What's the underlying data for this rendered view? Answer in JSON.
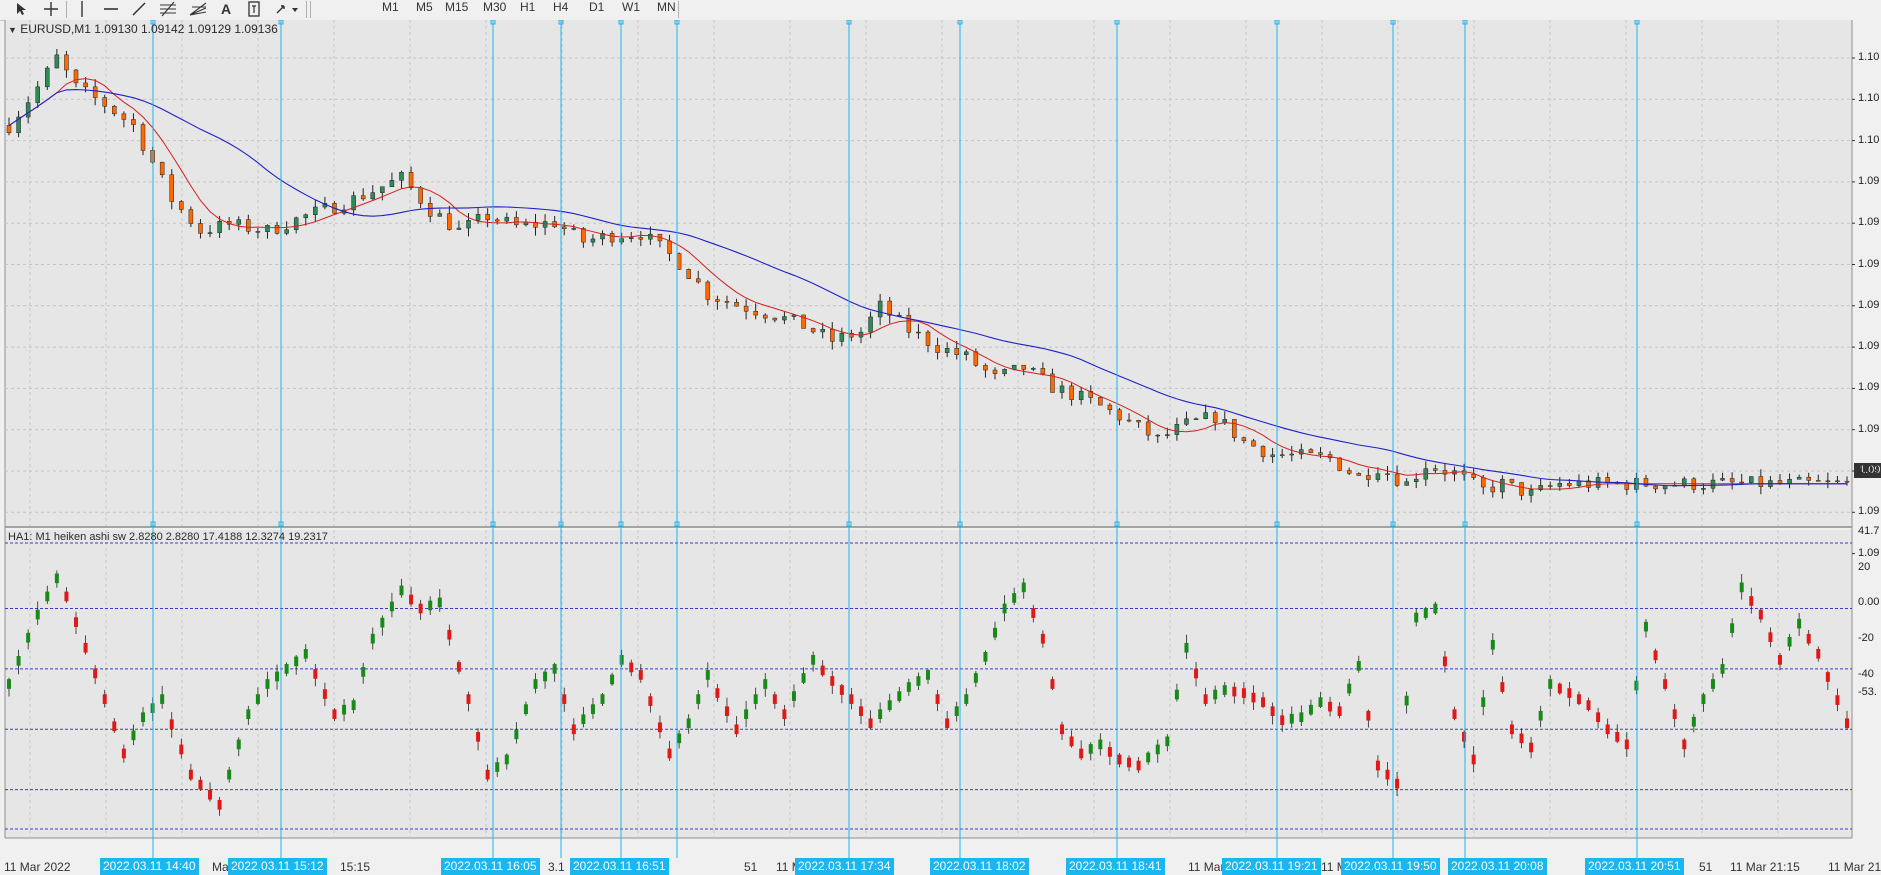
{
  "toolbar": {
    "tools": [
      "cursor-icon",
      "crosshair-icon",
      "vertical-line-icon",
      "horizontal-line-icon",
      "trendline-icon",
      "fibonacci-icon",
      "fibo-fan-icon",
      "text-icon",
      "label-icon",
      "arrows-icon"
    ],
    "text_tool_label": "A",
    "timeframes": [
      "M1",
      "M5",
      "M15",
      "M30",
      "H1",
      "H4",
      "D1",
      "W1",
      "MN"
    ]
  },
  "main_chart": {
    "title": "EURUSD,M1  1.09130 1.09142 1.09129 1.09136",
    "price_axis_labels": [
      "1.10",
      "1.10",
      "1.10",
      "1.09",
      "1.09",
      "1.09",
      "1.09",
      "1.09",
      "1.09",
      "1.09",
      "1.09",
      "1.09",
      "1.09"
    ],
    "current_price_label": "1.09"
  },
  "indicator": {
    "title": "HA1: M1 heiken ashi sw 2.8280 2.8280 17.4188 12.3274 19.2317",
    "axis_labels": [
      "41.7",
      "20",
      "0.00",
      "-20",
      "-40",
      "-53."
    ]
  },
  "time_axis": {
    "labels": [
      "11 Mar 2022",
      "Ma",
      "15:15",
      "11 Mar 1",
      "3.1",
      "2022.03.",
      "51",
      "11 M",
      "03",
      "11 Mar 18:5",
      "11 Mar",
      "51",
      "11 Mar 21:15",
      "11 Mar 21"
    ]
  },
  "vertical_line_labels": [
    "2022.03.11 14:40",
    "2022.03.11 15:12",
    "2022.03.11 16:05",
    "2022.03.11 16:51",
    "2022.03.11 17:34",
    "2022.03.11 18:02",
    "2022.03.11 18:41",
    "2022.03.11 19:21",
    "2022.03.11 19:50",
    "2022.03.11 20:08",
    "2022.03.11 20:51"
  ],
  "chart_data": {
    "type": "candlestick",
    "symbol": "EURUSD",
    "timeframe": "M1",
    "ohlc_last": {
      "open": 1.0913,
      "high": 1.09142,
      "low": 1.09129,
      "close": 1.09136
    },
    "x_range": [
      "11 Mar 2022 ~14:00",
      "11 Mar 2022 ~21:25"
    ],
    "price_path": [
      [
        0,
        1.103
      ],
      [
        3,
        1.1048
      ],
      [
        5,
        1.1062
      ],
      [
        7,
        1.1048
      ],
      [
        10,
        1.104
      ],
      [
        13,
        1.103
      ],
      [
        17,
        1.0995
      ],
      [
        20,
        1.098
      ],
      [
        23,
        1.0983
      ],
      [
        27,
        1.098
      ],
      [
        31,
        1.0987
      ],
      [
        36,
        1.0995
      ],
      [
        41,
        1.1005
      ],
      [
        44,
        1.099
      ],
      [
        47,
        1.098
      ],
      [
        50,
        1.0987
      ],
      [
        53,
        1.0982
      ],
      [
        57,
        1.0984
      ],
      [
        60,
        1.0975
      ],
      [
        63,
        1.0978
      ],
      [
        66,
        1.0979
      ],
      [
        70,
        1.0965
      ],
      [
        73,
        1.095
      ],
      [
        76,
        1.0945
      ],
      [
        80,
        1.094
      ],
      [
        83,
        1.0935
      ],
      [
        86,
        1.0928
      ],
      [
        89,
        1.0932
      ],
      [
        91,
        1.0944
      ],
      [
        94,
        1.0933
      ],
      [
        97,
        1.0925
      ],
      [
        100,
        1.092
      ],
      [
        103,
        1.091
      ],
      [
        106,
        1.0915
      ],
      [
        109,
        1.0906
      ],
      [
        113,
        1.0899
      ],
      [
        116,
        1.0892
      ],
      [
        120,
        1.0881
      ],
      [
        123,
        1.0888
      ],
      [
        126,
        1.0892
      ],
      [
        129,
        1.088
      ],
      [
        132,
        1.0874
      ],
      [
        135,
        1.0873
      ],
      [
        138,
        1.0872
      ],
      [
        141,
        1.0863
      ],
      [
        143,
        1.0868
      ],
      [
        146,
        1.086
      ],
      [
        148,
        1.0869
      ],
      [
        151,
        1.0865
      ],
      [
        154,
        1.0857
      ],
      [
        156,
        1.086
      ],
      [
        159,
        1.0855
      ],
      [
        162,
        1.086
      ]
    ],
    "moving_averages": [
      {
        "color": "#d42020",
        "role": "fast MA"
      },
      {
        "color": "#2020c8",
        "role": "slow MA"
      }
    ],
    "candle_colors": {
      "up": "#2e8b57",
      "down": "#ff6a00"
    },
    "indicator_series": {
      "name": "HA1: M1 heiken ashi sw",
      "levels": [
        41.7,
        20,
        0,
        -20,
        -40,
        -53
      ],
      "path": [
        [
          0,
          -5
        ],
        [
          3,
          18
        ],
        [
          5,
          30
        ],
        [
          6,
          24
        ],
        [
          10,
          -10
        ],
        [
          12,
          -28
        ],
        [
          14,
          -16
        ],
        [
          16,
          -10
        ],
        [
          19,
          -35
        ],
        [
          22,
          -45
        ],
        [
          25,
          -15
        ],
        [
          27,
          -5
        ],
        [
          31,
          5
        ],
        [
          34,
          -15
        ],
        [
          36,
          -12
        ],
        [
          38,
          10
        ],
        [
          41,
          26
        ],
        [
          43,
          20
        ],
        [
          45,
          22
        ],
        [
          48,
          -10
        ],
        [
          50,
          -35
        ],
        [
          52,
          -30
        ],
        [
          55,
          -5
        ],
        [
          57,
          0
        ],
        [
          59,
          -20
        ],
        [
          62,
          -10
        ],
        [
          64,
          3
        ],
        [
          66,
          -2
        ],
        [
          69,
          -28
        ],
        [
          71,
          -18
        ],
        [
          73,
          -2
        ],
        [
          76,
          -20
        ],
        [
          79,
          -5
        ],
        [
          81,
          -15
        ],
        [
          84,
          3
        ],
        [
          86,
          -4
        ],
        [
          88,
          -10
        ],
        [
          90,
          -18
        ],
        [
          92,
          -12
        ],
        [
          94,
          -6
        ],
        [
          96,
          -2
        ],
        [
          98,
          -18
        ],
        [
          100,
          -10
        ],
        [
          102,
          4
        ],
        [
          104,
          20
        ],
        [
          106,
          27
        ],
        [
          108,
          10
        ],
        [
          110,
          -20
        ],
        [
          112,
          -28
        ],
        [
          114,
          -25
        ],
        [
          116,
          -30
        ],
        [
          118,
          -32
        ],
        [
          121,
          -24
        ],
        [
          123,
          7
        ],
        [
          125,
          -10
        ],
        [
          127,
          -7
        ],
        [
          129,
          -8
        ],
        [
          131,
          -11
        ],
        [
          133,
          -17
        ],
        [
          135,
          -16
        ],
        [
          137,
          -11
        ],
        [
          139,
          -14
        ],
        [
          141,
          1
        ],
        [
          143,
          -32
        ],
        [
          145,
          -38
        ],
        [
          147,
          17
        ],
        [
          149,
          20
        ],
        [
          151,
          -15
        ],
        [
          153,
          -30
        ],
        [
          155,
          8
        ],
        [
          157,
          -20
        ],
        [
          159,
          -26
        ],
        [
          161,
          -5
        ],
        [
          163,
          -8
        ],
        [
          165,
          -12
        ],
        [
          167,
          -20
        ],
        [
          169,
          -25
        ],
        [
          171,
          14
        ],
        [
          173,
          -5
        ],
        [
          175,
          -25
        ],
        [
          177,
          -10
        ],
        [
          179,
          0
        ],
        [
          181,
          27
        ],
        [
          183,
          18
        ],
        [
          185,
          3
        ],
        [
          187,
          15
        ],
        [
          189,
          5
        ],
        [
          192,
          -18
        ]
      ]
    },
    "vertical_lines": [
      {
        "time": "2022.03.11 14:40",
        "label_shown": true
      },
      {
        "time": "2022.03.11 15:12",
        "label_shown": true
      },
      {
        "time": "2022.03.11 16:05",
        "label_shown": true
      },
      {
        "time": "2022.03.11 16:51",
        "label_shown": true
      },
      {
        "time": "2022.03.11 17:34",
        "label_shown": true
      },
      {
        "time": "2022.03.11 18:02",
        "label_shown": true
      },
      {
        "time": "2022.03.11 18:41",
        "label_shown": true
      },
      {
        "time": "2022.03.11 19:21",
        "label_shown": true
      },
      {
        "time": "2022.03.11 19:50",
        "label_shown": true
      },
      {
        "time": "2022.03.11 20:08",
        "label_shown": true
      },
      {
        "time": "2022.03.11 20:51",
        "label_shown": true
      },
      {
        "time": "",
        "label_shown": false
      },
      {
        "time": "",
        "label_shown": false
      }
    ],
    "grid": true
  }
}
